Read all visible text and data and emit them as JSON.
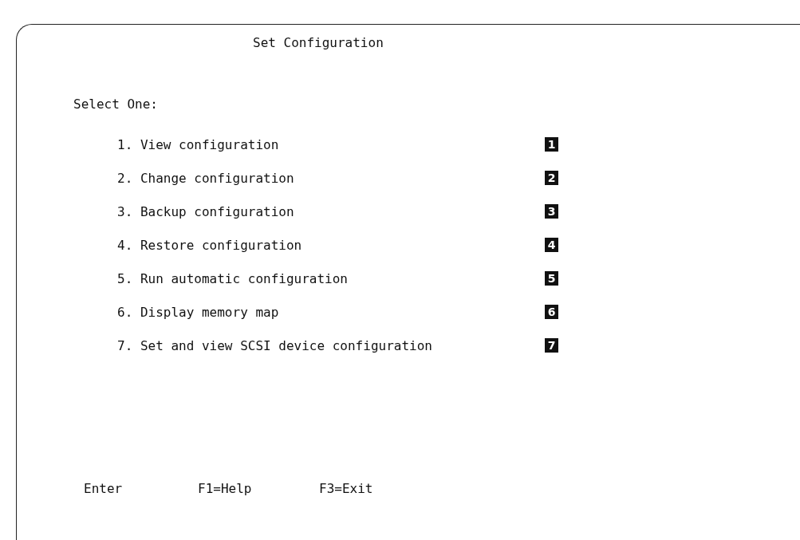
{
  "title": "Set Configuration",
  "prompt": "Select One:",
  "options": [
    {
      "text": "1. View configuration",
      "callout": "1"
    },
    {
      "text": "2. Change configuration",
      "callout": "2"
    },
    {
      "text": "3. Backup configuration",
      "callout": "3"
    },
    {
      "text": "4. Restore configuration",
      "callout": "4"
    },
    {
      "text": "5. Run automatic configuration",
      "callout": "5"
    },
    {
      "text": "6. Display memory map",
      "callout": "6"
    },
    {
      "text": "7. Set and view SCSI device configuration",
      "callout": "7"
    }
  ],
  "keys": [
    "Enter",
    "F1=Help",
    "F3=Exit"
  ]
}
